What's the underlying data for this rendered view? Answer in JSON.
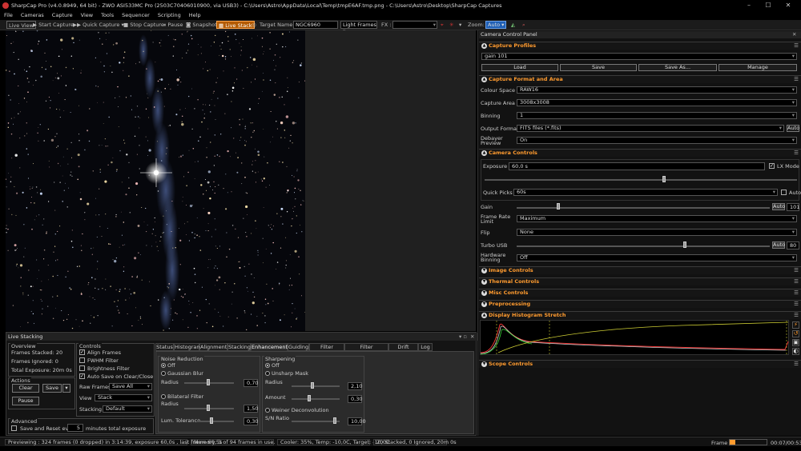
{
  "window": {
    "title": "SharpCap Pro (v4.0.8949, 64 bit) - ZWO ASI533MC Pro (2503C70406010900, via USB3) - C:\\Users\\Astro\\AppData\\Local\\Temp\\tmpE6AF.tmp.png - C:\\Users\\Astro\\Desktop\\SharpCap Captures"
  },
  "menu": [
    "File",
    "Cameras",
    "Capture",
    "View",
    "Tools",
    "Sequencer",
    "Scripting",
    "Help"
  ],
  "toolbar": {
    "live_view": "Live View",
    "start_capture": "Start Capture",
    "quick_capture": "Quick Capture",
    "stop_capture": "Stop Capture",
    "pause": "Pause",
    "snapshot": "Snapshot",
    "live_stack": "Live Stack",
    "target_label": "Target Name :",
    "target_value": "NGC6960",
    "frame_type": "Light Frames",
    "fx_label": "FX :",
    "zoom_label": "Zoom:",
    "zoom_value": "Auto"
  },
  "panel": {
    "title": "Camera Control Panel",
    "profiles": {
      "header": "Capture Profiles",
      "current": "gain 101",
      "load": "Load",
      "save": "Save",
      "save_as": "Save As...",
      "manage": "Manage"
    },
    "format": {
      "header": "Capture Format and Area",
      "colour_space_label": "Colour Space",
      "colour_space": "RAW16",
      "capture_area_label": "Capture Area",
      "capture_area": "3008x3008",
      "binning_label": "Binning",
      "binning": "1",
      "output_format_label": "Output Format",
      "output_format": "FITS files (*.fits)",
      "auto": "Auto",
      "debayer_label": "Debayer Preview",
      "debayer": "On"
    },
    "controls": {
      "header": "Camera Controls",
      "exposure_label": "Exposure",
      "exposure": "60,0 s",
      "lx_mode": "LX Mode",
      "quick_picks_label": "Quick Picks",
      "quick_picks": "60s",
      "auto": "Auto",
      "gain_label": "Gain",
      "gain_value": "101",
      "frame_rate_label": "Frame Rate Limit",
      "frame_rate": "Maximum",
      "flip_label": "Flip",
      "flip": "None",
      "turbo_label": "Turbo USB",
      "turbo_value": "80",
      "hw_binning_label": "Hardware Binning",
      "hw_binning": "Off"
    },
    "collapsed": [
      "Image Controls",
      "Thermal Controls",
      "Misc Controls",
      "Preprocessing"
    ],
    "histogram": "Display Histogram Stretch",
    "scope": "Scope Controls"
  },
  "livestack": {
    "title": "Live Stacking",
    "overview": {
      "label": "Overview",
      "stacked": "Frames Stacked: 20",
      "ignored": "Frames Ignored: 0",
      "total": "Total Exposure:   20m 0s"
    },
    "actions": {
      "label": "Actions",
      "clear": "Clear",
      "save": "Save",
      "pause": "Pause"
    },
    "advanced": {
      "label": "Advanced",
      "save_reset": "Save and Reset every",
      "minutes_value": "5",
      "minutes": "minutes total exposure"
    },
    "controls": {
      "label": "Controls",
      "align": "Align Frames",
      "fwhm": "FWHM Filter",
      "brightness": "Brightness Filter",
      "autosave": "Auto Save on Clear/Close",
      "raw_label": "Raw Frames",
      "raw": "Save All",
      "view_label": "View",
      "view": "Stack",
      "stacking_label": "Stacking",
      "stacking": "Default"
    },
    "tabs": [
      "Status",
      "Histogram",
      "Alignment",
      "Stacking",
      "Enhancement",
      "Guiding",
      "Filter (FWHM)",
      "Filter (Brightness)",
      "Drift Graph",
      "Log"
    ],
    "noise": {
      "label": "Noise Reduction",
      "off": "Off",
      "gaussian": "Gaussian Blur",
      "radius": "Radius",
      "radius_val": "0,70",
      "bilateral": "Bilateral Filter",
      "b_radius": "Radius",
      "b_radius_val": "1,50",
      "lum": "Lum. Tolerance",
      "lum_val": "0,30"
    },
    "sharpen": {
      "label": "Sharpening",
      "off": "Off",
      "unsharp": "Unsharp Mask",
      "radius": "Radius",
      "radius_val": "2,10",
      "amount": "Amount",
      "amount_val": "0,30",
      "wiener": "Weiner Deconvolution",
      "snr": "S/N Ratio",
      "snr_val": "10,00"
    }
  },
  "status": {
    "preview": "Previewing : 324 frames (0 dropped) in 3:14:39, exposure 60,0s , last frame 60,5s",
    "memory": "Memory: 3 of 94 frames in use.",
    "cooler": "Cooler: 35%, Temp: -10,0C, Target: -10,0C",
    "stack": "20 Stacked, 0 Ignored, 20m 0s",
    "frame_label": "Frame :",
    "time": "00:07/00:53"
  },
  "colors": {
    "accent": "#ff9b2f",
    "live_on": "#b35a00"
  }
}
